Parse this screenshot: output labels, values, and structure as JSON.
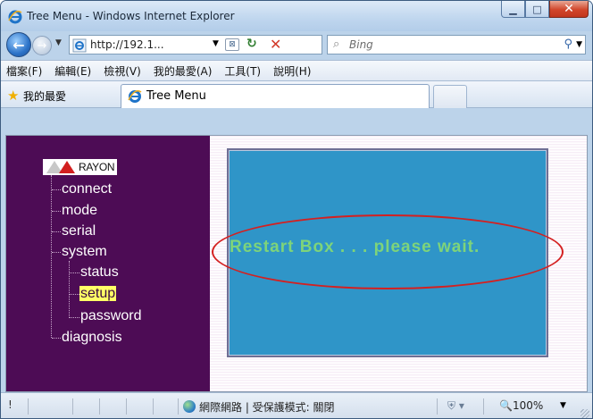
{
  "window": {
    "title": "Tree Menu - Windows Internet Explorer"
  },
  "address_bar": {
    "url": "http://192.1...",
    "search_placeholder": "Bing"
  },
  "menubar": {
    "items": [
      "檔案(F)",
      "編輯(E)",
      "檢視(V)",
      "我的最愛(A)",
      "工具(T)",
      "說明(H)"
    ]
  },
  "favorites_bar": {
    "favorites_label": "我的最愛",
    "tab_label": "Tree Menu"
  },
  "tree": {
    "root_label": "RAYON",
    "nodes": [
      "connect",
      "mode",
      "serial",
      "system",
      "status",
      "setup",
      "password",
      "diagnosis"
    ],
    "selected": "setup"
  },
  "panel": {
    "message": "Restart Box . . . please wait.",
    "background_color": "#2f95c8",
    "message_color": "#7ed47a",
    "annotation_color": "#d42020"
  },
  "statusbar": {
    "left_text": "!",
    "zone_text": "網際網路 | 受保護模式: 關閉",
    "zoom": "100%"
  }
}
